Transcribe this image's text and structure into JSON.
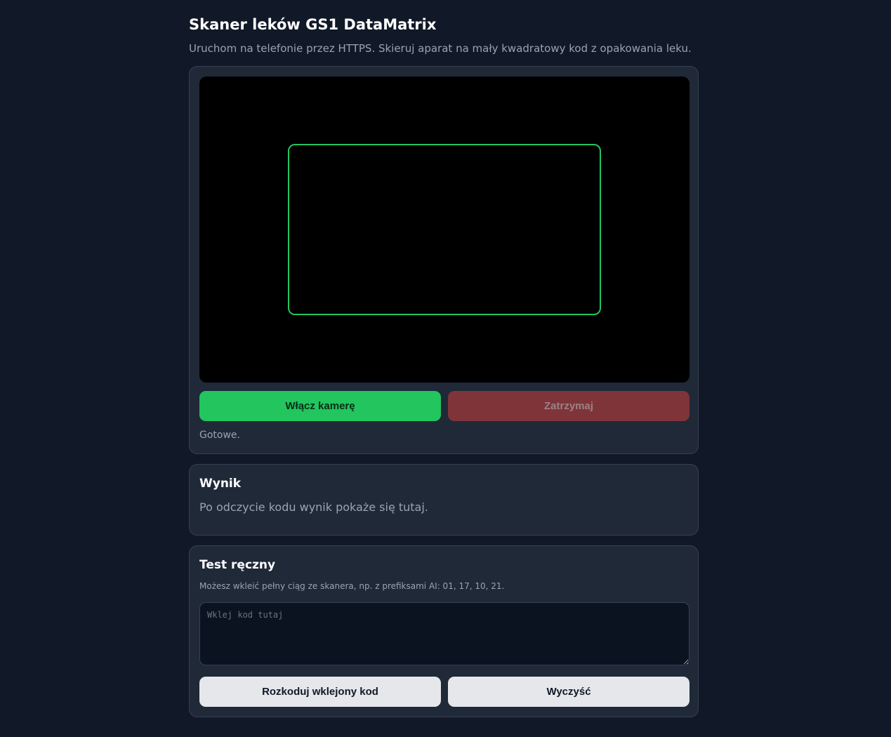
{
  "header": {
    "title": "Skaner leków GS1 DataMatrix",
    "subtitle": "Uruchom na telefonie przez HTTPS. Skieruj aparat na mały kwadratowy kod z opakowania leku."
  },
  "scanner": {
    "start_label": "Włącz kamerę",
    "stop_label": "Zatrzymaj",
    "status": "Gotowe."
  },
  "result": {
    "heading": "Wynik",
    "text": "Po odczycie kodu wynik pokaże się tutaj."
  },
  "manual": {
    "heading": "Test ręczny",
    "hint": "Możesz wkleić pełny ciąg ze skanera, np. z prefiksami AI: 01, 17, 10, 21.",
    "input_value": "",
    "input_placeholder": "Wklej kod tutaj",
    "decode_label": "Rozkoduj wklejony kod",
    "clear_label": "Wyczyść"
  },
  "colors": {
    "background": "#111827",
    "card": "#1f2937",
    "accent_green": "#22c55e",
    "stop_red": "#7f343a"
  }
}
